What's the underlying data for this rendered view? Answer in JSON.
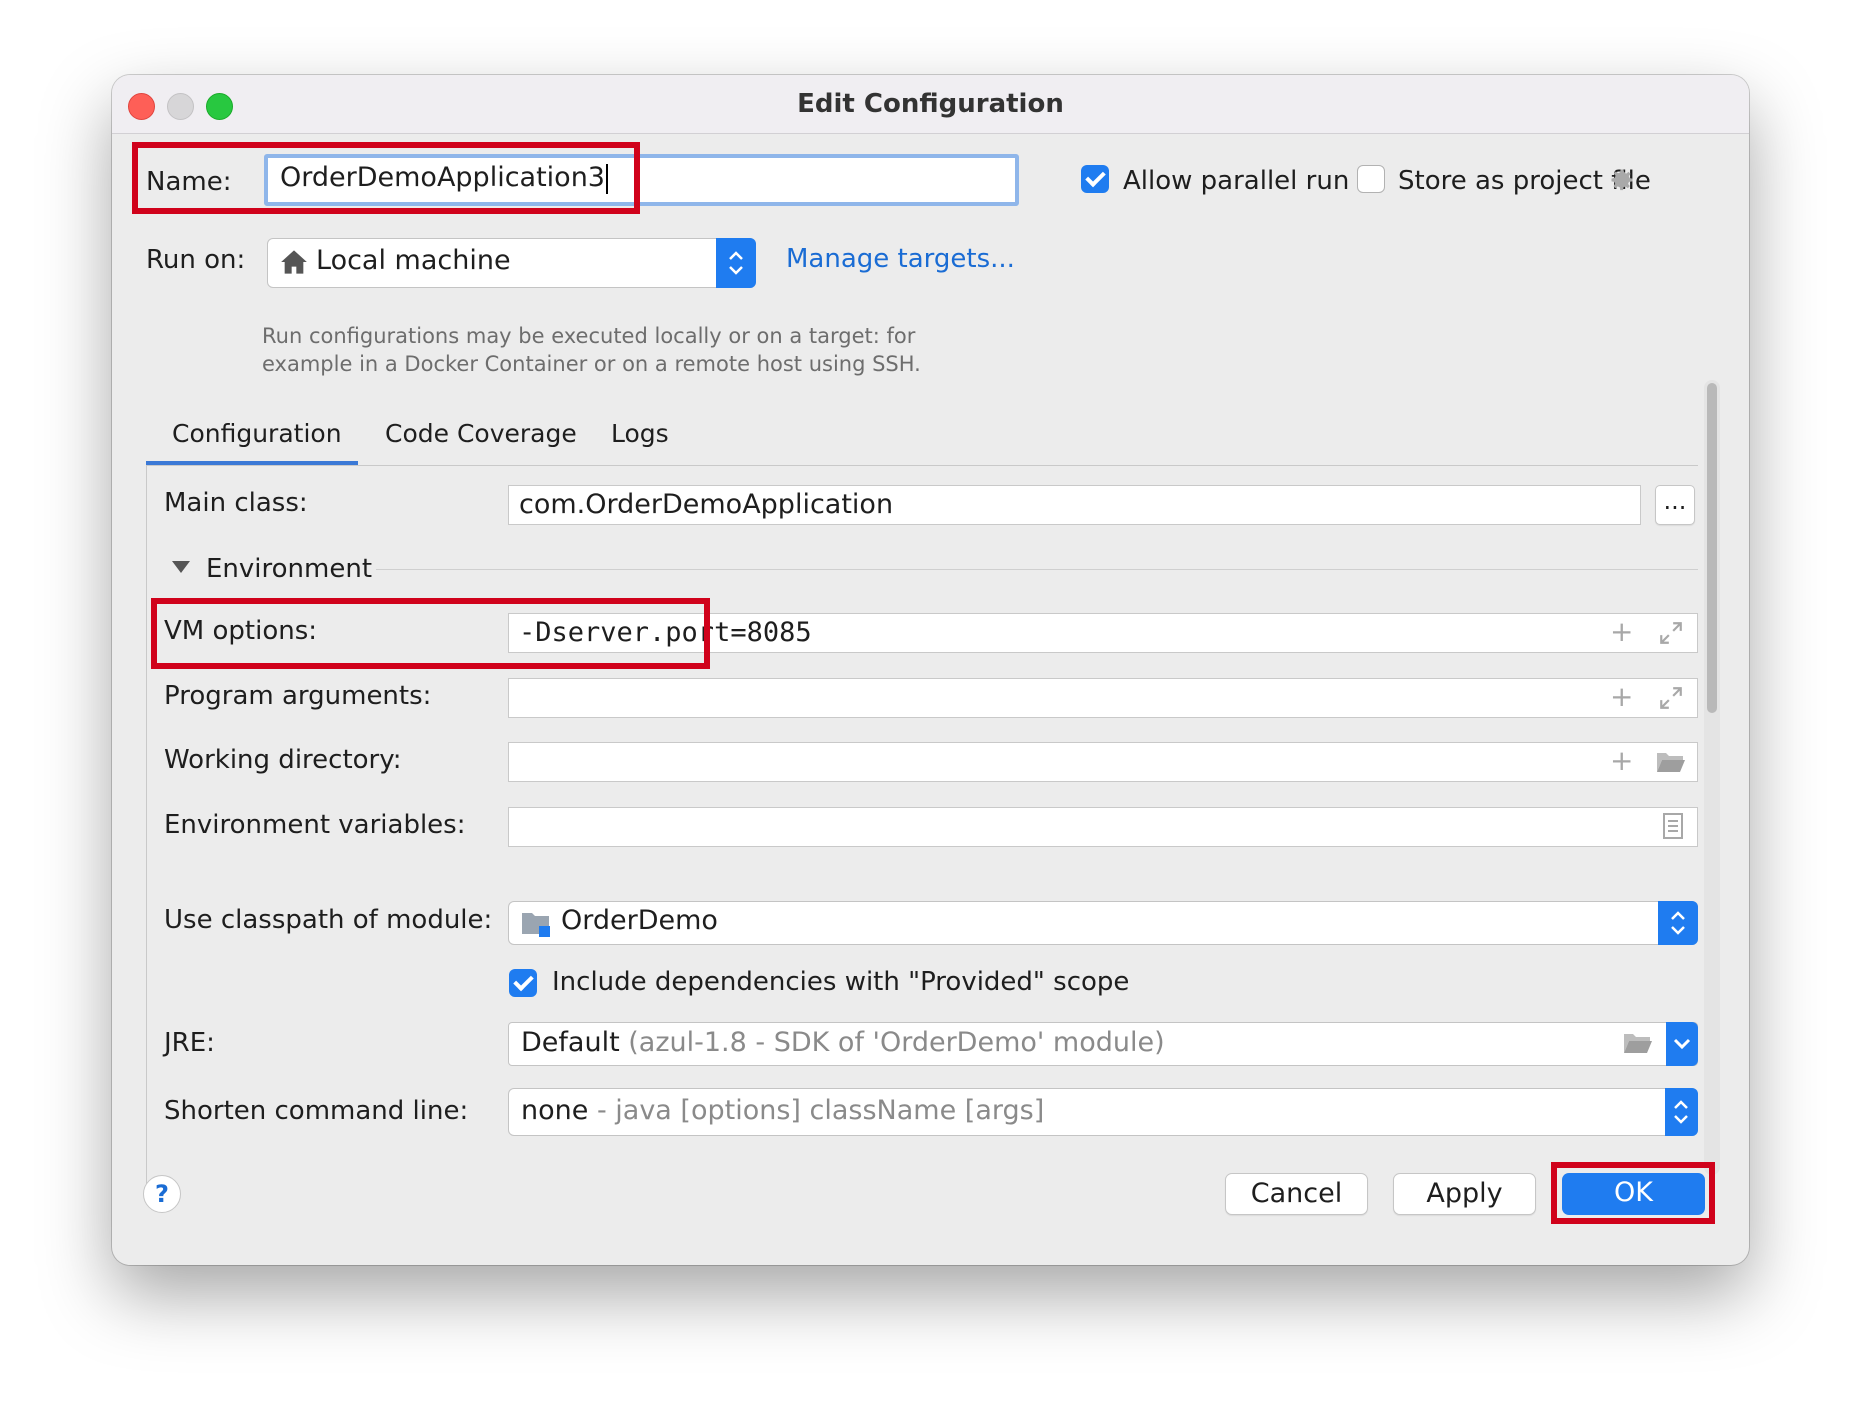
{
  "window": {
    "title": "Edit Configuration"
  },
  "name_row": {
    "label": "Name:",
    "value": "OrderDemoApplication3",
    "allow_parallel_label": "Allow parallel run",
    "allow_parallel_checked": true,
    "store_project_label": "Store as project file",
    "store_project_checked": false
  },
  "run_on": {
    "label": "Run on:",
    "value": "Local machine",
    "manage_link": "Manage targets...",
    "hint_line1": "Run configurations may be executed locally or on a target: for",
    "hint_line2": "example in a Docker Container or on a remote host using SSH."
  },
  "tabs": [
    {
      "label": "Configuration",
      "active": true
    },
    {
      "label": "Code Coverage",
      "active": false
    },
    {
      "label": "Logs",
      "active": false
    }
  ],
  "form": {
    "main_class_label": "Main class:",
    "main_class_value": "com.OrderDemoApplication",
    "browse_label": "...",
    "environment_label": "Environment",
    "vm_options_label": "VM options:",
    "vm_options_value": "-Dserver.port=8085",
    "program_args_label": "Program arguments:",
    "program_args_value": "",
    "working_dir_label": "Working directory:",
    "working_dir_value": "",
    "env_vars_label": "Environment variables:",
    "env_vars_value": "",
    "classpath_label": "Use classpath of module:",
    "classpath_value": "OrderDemo",
    "include_deps_label": "Include dependencies with \"Provided\" scope",
    "include_deps_checked": true,
    "jre_label": "JRE:",
    "jre_value": "Default",
    "jre_detail": "(azul-1.8 - SDK of 'OrderDemo' module)",
    "shorten_label": "Shorten command line:",
    "shorten_value": "none",
    "shorten_detail": "- java [options] className [args]"
  },
  "footer": {
    "help_label": "?",
    "cancel_label": "Cancel",
    "apply_label": "Apply",
    "ok_label": "OK"
  },
  "colors": {
    "accent": "#1f7cf0",
    "highlight_box": "#d0021b",
    "link": "#1a6cd4"
  },
  "icons": [
    "gear-icon",
    "home-icon",
    "plus-icon",
    "expand-icon",
    "folder-icon",
    "document-icon",
    "module-folder-icon",
    "chevron-down-icon",
    "updown-chevron-icon",
    "disclosure-triangle-icon",
    "help-icon"
  ]
}
